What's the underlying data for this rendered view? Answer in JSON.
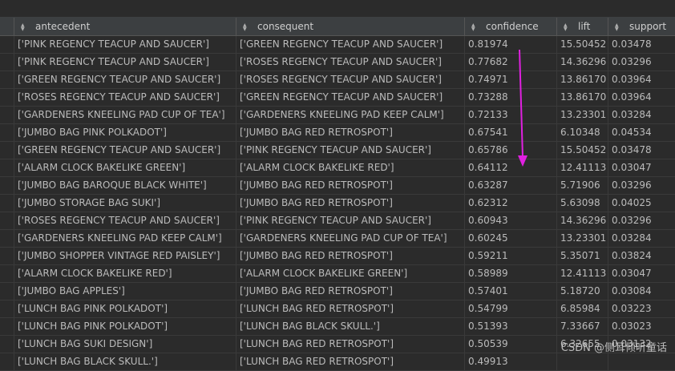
{
  "headers": {
    "antecedent": "antecedent",
    "consequent": "consequent",
    "confidence": "confidence",
    "lift": "lift",
    "support": "support"
  },
  "rows": [
    {
      "antecedent": "['PINK REGENCY TEACUP AND SAUCER']",
      "consequent": "['GREEN REGENCY TEACUP AND SAUCER']",
      "confidence": "0.81974",
      "lift": "15.50452",
      "support": "0.03478"
    },
    {
      "antecedent": "['PINK REGENCY TEACUP AND SAUCER']",
      "consequent": "['ROSES REGENCY TEACUP AND SAUCER']",
      "confidence": "0.77682",
      "lift": "14.36296",
      "support": "0.03296"
    },
    {
      "antecedent": "['GREEN REGENCY TEACUP AND SAUCER']",
      "consequent": "['ROSES REGENCY TEACUP AND SAUCER']",
      "confidence": "0.74971",
      "lift": "13.86170",
      "support": "0.03964"
    },
    {
      "antecedent": "['ROSES REGENCY TEACUP AND SAUCER']",
      "consequent": "['GREEN REGENCY TEACUP AND SAUCER']",
      "confidence": "0.73288",
      "lift": "13.86170",
      "support": "0.03964"
    },
    {
      "antecedent": "['GARDENERS KNEELING PAD CUP OF TEA']",
      "consequent": "['GARDENERS KNEELING PAD KEEP CALM']",
      "confidence": "0.72133",
      "lift": "13.23301",
      "support": "0.03284"
    },
    {
      "antecedent": "['JUMBO BAG PINK POLKADOT']",
      "consequent": "['JUMBO BAG RED RETROSPOT']",
      "confidence": "0.67541",
      "lift": "6.10348",
      "support": "0.04534"
    },
    {
      "antecedent": "['GREEN REGENCY TEACUP AND SAUCER']",
      "consequent": "['PINK REGENCY TEACUP AND SAUCER']",
      "confidence": "0.65786",
      "lift": "15.50452",
      "support": "0.03478"
    },
    {
      "antecedent": "['ALARM CLOCK BAKELIKE GREEN']",
      "consequent": "['ALARM CLOCK BAKELIKE RED']",
      "confidence": "0.64112",
      "lift": "12.41113",
      "support": "0.03047"
    },
    {
      "antecedent": "['JUMBO  BAG BAROQUE BLACK WHITE']",
      "consequent": "['JUMBO BAG RED RETROSPOT']",
      "confidence": "0.63287",
      "lift": "5.71906",
      "support": "0.03296"
    },
    {
      "antecedent": "['JUMBO STORAGE BAG SUKI']",
      "consequent": "['JUMBO BAG RED RETROSPOT']",
      "confidence": "0.62312",
      "lift": "5.63098",
      "support": "0.04025"
    },
    {
      "antecedent": "['ROSES REGENCY TEACUP AND SAUCER']",
      "consequent": "['PINK REGENCY TEACUP AND SAUCER']",
      "confidence": "0.60943",
      "lift": "14.36296",
      "support": "0.03296"
    },
    {
      "antecedent": "['GARDENERS KNEELING PAD KEEP CALM']",
      "consequent": "['GARDENERS KNEELING PAD CUP OF TEA']",
      "confidence": "0.60245",
      "lift": "13.23301",
      "support": "0.03284"
    },
    {
      "antecedent": "['JUMBO SHOPPER VINTAGE RED PAISLEY']",
      "consequent": "['JUMBO BAG RED RETROSPOT']",
      "confidence": "0.59211",
      "lift": "5.35071",
      "support": "0.03824"
    },
    {
      "antecedent": "['ALARM CLOCK BAKELIKE RED']",
      "consequent": "['ALARM CLOCK BAKELIKE GREEN']",
      "confidence": "0.58989",
      "lift": "12.41113",
      "support": "0.03047"
    },
    {
      "antecedent": "['JUMBO BAG APPLES']",
      "consequent": "['JUMBO BAG RED RETROSPOT']",
      "confidence": "0.57401",
      "lift": "5.18720",
      "support": "0.03084"
    },
    {
      "antecedent": "['LUNCH BAG PINK POLKADOT']",
      "consequent": "['LUNCH BAG RED RETROSPOT']",
      "confidence": "0.54799",
      "lift": "6.85984",
      "support": "0.03223"
    },
    {
      "antecedent": "['LUNCH BAG PINK POLKADOT']",
      "consequent": "['LUNCH BAG  BLACK SKULL.']",
      "confidence": "0.51393",
      "lift": "7.33667",
      "support": "0.03023"
    },
    {
      "antecedent": "['LUNCH BAG SUKI DESIGN']",
      "consequent": "['LUNCH BAG RED RETROSPOT']",
      "confidence": "0.50539",
      "lift": "6.32655",
      "support": "0.03132"
    },
    {
      "antecedent": "['LUNCH BAG  BLACK SKULL.']",
      "consequent": "['LUNCH BAG RED RETROSPOT']",
      "confidence": "0.49913",
      "lift": "",
      "support": ""
    }
  ],
  "watermark": "CSDN @侧耳倾听童话",
  "colors": {
    "arrow": "#e020e0",
    "background": "#2b2b2b",
    "header": "#3c3f41"
  }
}
